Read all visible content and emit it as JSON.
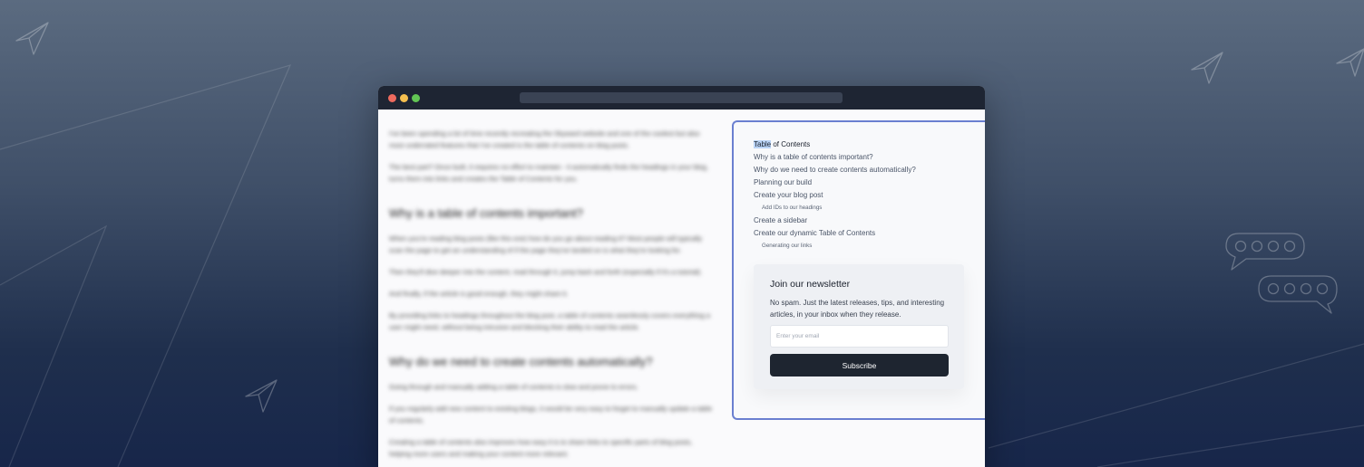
{
  "article": {
    "paragraphs_1": [
      "I've been spending a lot of time recently recreating the Skyward website and one of the coolest but also most underrated features that I've created is the table of contents on blog posts.",
      "The best part? Once built, it requires no effort to maintain - it automatically finds the headings in your blog, turns them into links and creates the Table of Contents for you."
    ],
    "heading_1": "Why is a table of contents important?",
    "paragraphs_2": [
      "When you're reading blog posts (like this one) how do you go about reading it? Most people will typically scan the page to get an understanding of if the page they've landed on is what they're looking for.",
      "Then they'll dive deeper into the content, read through it, jump back and forth (especially if it's a tutorial).",
      "And finally, if the article is good enough, they might share it.",
      "By providing links to headings throughout the blog post, a table of contents seamlessly covers everything a user might need, without being intrusive and blocking their ability to read the article."
    ],
    "heading_2": "Why do we need to create contents automatically?",
    "paragraphs_3": [
      "Going through and manually adding a table of contents is slow and prone to errors.",
      "If you regularly add new content to existing blogs, it would be very easy to forget to manually update a table of contents.",
      "Creating a table of contents also improves how easy it is to share links to specific parts of blog posts, helping more users and making your content more relevant."
    ]
  },
  "toc": {
    "title_highlight": "Table",
    "title_rest": " of Contents",
    "items": [
      "Why is a table of contents important?",
      "Why do we need to create contents automatically?",
      "Planning our build",
      "Create your blog post",
      "Add IDs to our headings",
      "Create a sidebar",
      "Create our dynamic Table of Contents",
      "Generating our links"
    ]
  },
  "newsletter": {
    "title": "Join our newsletter",
    "description": "No spam. Just the latest releases, tips, and interesting articles, in your inbox when they release.",
    "email_placeholder": "Enter your email",
    "button_label": "Subscribe"
  },
  "colors": {
    "accent_border": "#6a7fd0",
    "button_bg": "#1e2530",
    "titlebar_bg": "#1e2533"
  }
}
